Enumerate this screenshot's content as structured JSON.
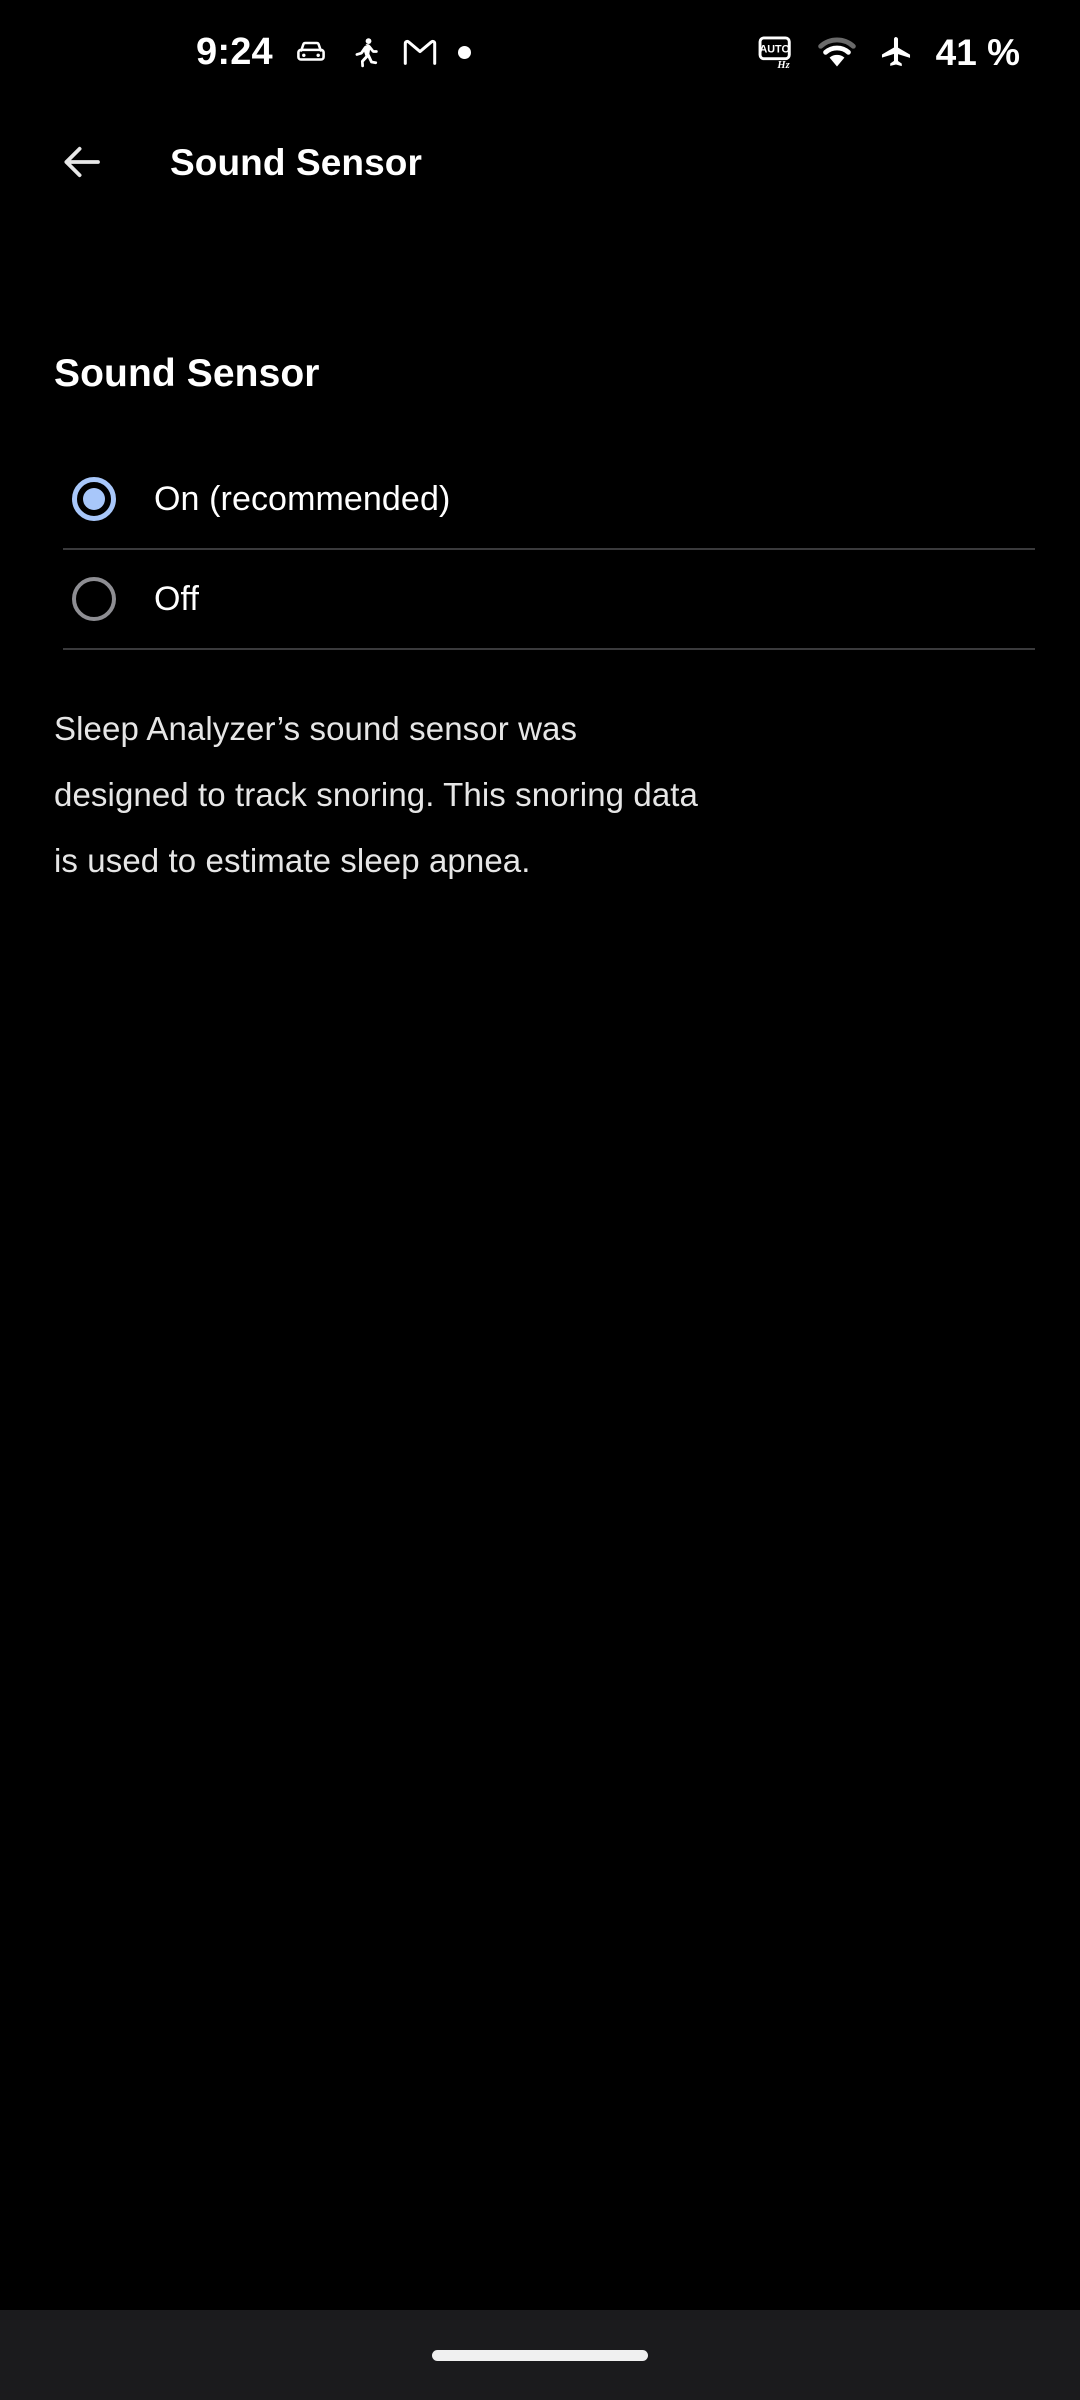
{
  "status_bar": {
    "time": "9:24",
    "battery": "41 %",
    "left_icons": [
      {
        "name": "car-icon",
        "label": "Driving mode"
      },
      {
        "name": "running-person-icon",
        "label": "Activity tracking"
      },
      {
        "name": "gmail-icon",
        "label": "Gmail notification"
      },
      {
        "name": "notification-dot-icon",
        "label": "Notification"
      }
    ],
    "right_icons": [
      {
        "name": "auto-hz-icon",
        "label": "AUTO Hz",
        "text_top": "AUTO",
        "text_bottom": "Hz"
      },
      {
        "name": "wifi-icon",
        "label": "Wi-Fi connected"
      },
      {
        "name": "airplane-mode-icon",
        "label": "Airplane mode"
      }
    ]
  },
  "app_bar": {
    "back_label": "Back",
    "title": "Sound Sensor"
  },
  "page": {
    "heading": "Sound Sensor",
    "description": "Sleep Analyzer’s sound sensor was designed to track snoring. This snoring data is used to estimate sleep apnea."
  },
  "radio_group": {
    "name": "sound-sensor-setting",
    "selected": "on",
    "options": [
      {
        "id": "on",
        "label": "On (recommended)",
        "checked": true
      },
      {
        "id": "off",
        "label": "Off",
        "checked": false
      }
    ]
  },
  "nav_bar": {
    "gesture_handle_label": "Home gesture handle"
  },
  "colors": {
    "background": "#000000",
    "accent_blue": "#a8c7fa",
    "radio_unselected": "#8e8e93",
    "divider": "#3a3a3c",
    "text_primary": "#ffffff",
    "text_secondary": "#e6e6e6",
    "nav_bar_background": "#1b1b1d"
  }
}
